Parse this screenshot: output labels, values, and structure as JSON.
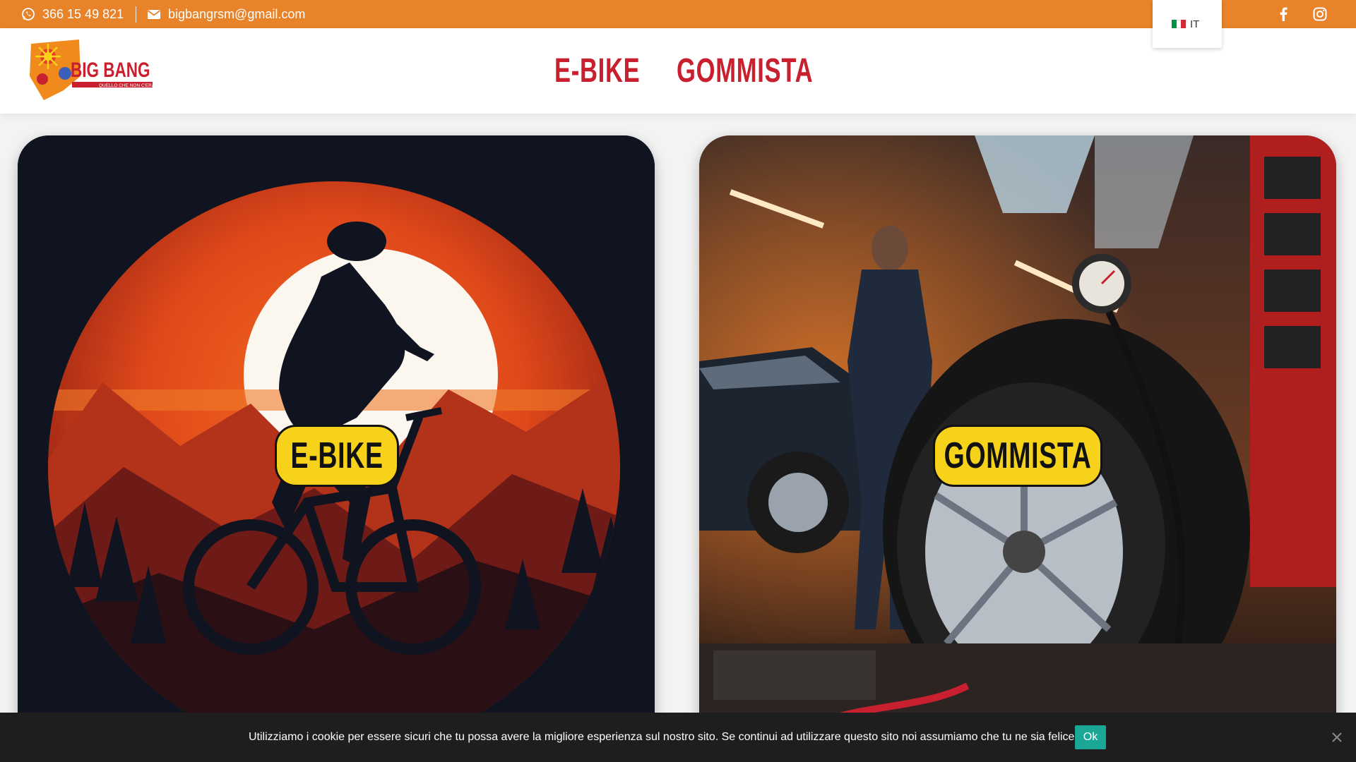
{
  "topbar": {
    "phone": "366 15 49 821",
    "email": "bigbangrsm@gmail.com",
    "language": "IT",
    "phone_icon": "whatsapp-icon",
    "email_icon": "envelope-icon",
    "social": [
      "facebook-icon",
      "instagram-icon"
    ],
    "color": "#e8832a"
  },
  "header": {
    "logo_text": "BIG BANG",
    "logo_tagline": "QUELLO CHE NON C'ERA",
    "nav": [
      "E-BIKE",
      "GOMMISTA"
    ],
    "nav_color": "#c8202f"
  },
  "cards": [
    {
      "label": "E-BIKE",
      "image": "mountain bike rider silhouette at sunset"
    },
    {
      "label": "GOMMISTA",
      "image": "tyre workshop with mechanic"
    }
  ],
  "badge_color": "#f6d21b",
  "cookie": {
    "message": "Utilizziamo i cookie per essere sicuri che tu possa avere la migliore esperienza sul nostro sito. Se continui ad utilizzare questo sito noi assumiamo che tu ne sia felice.",
    "ok_label": "Ok",
    "ok_color": "#1aa795"
  }
}
